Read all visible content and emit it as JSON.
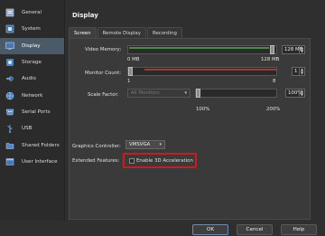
{
  "sidebar": {
    "items": [
      {
        "label": "General",
        "icon": "general-icon"
      },
      {
        "label": "System",
        "icon": "system-icon"
      },
      {
        "label": "Display",
        "icon": "display-icon"
      },
      {
        "label": "Storage",
        "icon": "storage-icon"
      },
      {
        "label": "Audio",
        "icon": "audio-icon"
      },
      {
        "label": "Network",
        "icon": "network-icon"
      },
      {
        "label": "Serial Ports",
        "icon": "serial-ports-icon"
      },
      {
        "label": "USB",
        "icon": "usb-icon"
      },
      {
        "label": "Shared Folders",
        "icon": "shared-folders-icon"
      },
      {
        "label": "User Interface",
        "icon": "user-interface-icon"
      }
    ],
    "active_index": 2
  },
  "header": {
    "title": "Display"
  },
  "tabs": [
    {
      "label": "Screen"
    },
    {
      "label": "Remote Display"
    },
    {
      "label": "Recording"
    }
  ],
  "screen": {
    "video_memory": {
      "label": "Video Memory:",
      "value": "128 MB",
      "min_label": "0 MB",
      "max_label": "128 MB",
      "fraction": 1.0
    },
    "monitor_count": {
      "label": "Monitor Count:",
      "value": "1",
      "min_label": "1",
      "max_label": "8",
      "fraction": 0.0
    },
    "scale_factor": {
      "label": "Scale Factor:",
      "combo_value": "All Monitors",
      "value": "100%",
      "min_label": "100%",
      "max_label": "200%",
      "fraction": 0.0
    },
    "graphics_controller": {
      "label": "Graphics Controller:",
      "value": "VMSVGA"
    },
    "extended_features": {
      "label": "Extended Features:",
      "checkbox_label": "Enable 3D Acceleration",
      "checked": false
    }
  },
  "footer": {
    "ok": "OK",
    "cancel": "Cancel",
    "help": "Help"
  },
  "colors": {
    "active_sidebar": "#4a5a66",
    "highlight_box": "#d01a1a",
    "slider_green": "#4e8a4e",
    "slider_red": "#9b3b3b"
  }
}
